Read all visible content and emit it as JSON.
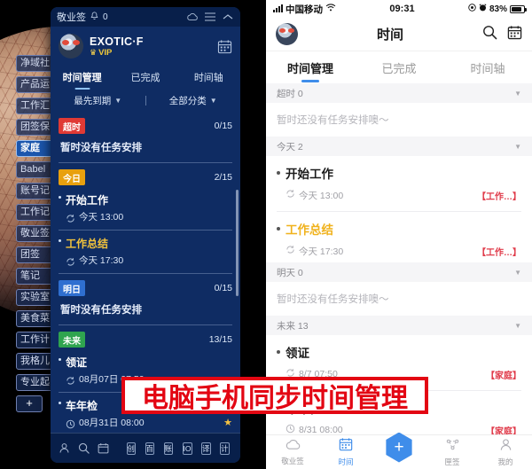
{
  "desktop": {
    "categories": [
      {
        "label": "净域社",
        "selected": false
      },
      {
        "label": "产品运",
        "selected": false
      },
      {
        "label": "工作汇",
        "selected": false
      },
      {
        "label": "团签保",
        "selected": false
      },
      {
        "label": "家庭",
        "selected": true
      },
      {
        "label": "Babel",
        "selected": false
      },
      {
        "label": "账号记",
        "selected": false
      },
      {
        "label": "工作记",
        "selected": false
      },
      {
        "label": "敬业签",
        "selected": false
      },
      {
        "label": "团签",
        "selected": false
      },
      {
        "label": "笔记",
        "selected": false
      },
      {
        "label": "实验室",
        "selected": false
      },
      {
        "label": "美食菜",
        "selected": false
      },
      {
        "label": "工作计",
        "selected": false
      },
      {
        "label": "我格儿",
        "selected": false
      },
      {
        "label": "专业起",
        "selected": false
      }
    ],
    "add_label": "+"
  },
  "window": {
    "titlebar": {
      "app_name": "敬业签",
      "bell_count": "0",
      "cloud_icon": "cloud-icon",
      "menu_icon": "hamburger-menu-icon",
      "minimize_icon": "chevron-up-icon"
    },
    "profile": {
      "username": "EXOTIC·F",
      "vip_label": "VIP",
      "crown": "♛",
      "calendar_icon": "calendar-icon"
    },
    "tabs": [
      {
        "label": "时间管理",
        "active": true
      },
      {
        "label": "已完成",
        "active": false
      },
      {
        "label": "时间轴",
        "active": false
      }
    ],
    "filters": {
      "sort_label": "最先到期",
      "category_label": "全部分类"
    },
    "groups": [
      {
        "badge": "超时",
        "badge_color": "#e03a35",
        "count": "0/15",
        "empty_text": "暂时没有任务安排",
        "tasks": []
      },
      {
        "badge": "今日",
        "badge_color": "#e8a00e",
        "count": "2/15",
        "empty_text": "",
        "tasks": [
          {
            "title": "开始工作",
            "time": "今天 13:00",
            "warn": false,
            "starred": false,
            "icon": "repeat-icon"
          },
          {
            "title": "工作总结",
            "time": "今天 17:30",
            "warn": true,
            "starred": false,
            "icon": "repeat-icon"
          }
        ]
      },
      {
        "badge": "明日",
        "badge_color": "#2f6fd0",
        "count": "0/15",
        "empty_text": "暂时没有任务安排",
        "tasks": []
      },
      {
        "badge": "未来",
        "badge_color": "#2fa44f",
        "count": "13/15",
        "empty_text": "",
        "tasks": [
          {
            "title": "领证",
            "time": "08月07日 07:50",
            "warn": false,
            "starred": false,
            "icon": "repeat-icon"
          },
          {
            "title": "车年检",
            "time": "08月31日 08:00",
            "warn": false,
            "starred": true,
            "icon": "clock-icon"
          }
        ]
      }
    ],
    "toolbar": {
      "user_icon": "user-icon",
      "search_icon": "search-icon",
      "calendar_icon": "calendar-icon",
      "quick_buttons": [
        "创",
        "百",
        "账",
        "IO",
        "译",
        "计"
      ],
      "more_icon": "vertical-dots-icon"
    }
  },
  "phone": {
    "statusbar": {
      "carrier": "中国移动",
      "signal_icon": "signal-bars-icon",
      "wifi_icon": "wifi-icon",
      "time": "09:31",
      "location_icon": "location-icon",
      "alarm_icon": "alarm-icon",
      "battery_percent": "83%",
      "battery_icon": "battery-icon"
    },
    "header": {
      "title": "时间",
      "avatar": "user-avatar",
      "search_icon": "search-icon",
      "calendar_icon": "calendar-icon"
    },
    "tabs": [
      {
        "label": "时间管理",
        "active": true
      },
      {
        "label": "已完成",
        "active": false
      },
      {
        "label": "时间轴",
        "active": false
      }
    ],
    "sections": [
      {
        "title": "超时 0",
        "empty_text": "暂时还没有任务安排噢～",
        "tasks": []
      },
      {
        "title": "今天 2",
        "empty_text": "",
        "tasks": [
          {
            "title": "开始工作",
            "time": "今天 13:00",
            "tag": "【工作…】",
            "warn": false,
            "icon": "repeat-icon"
          },
          {
            "title": "工作总结",
            "time": "今天 17:30",
            "tag": "【工作…】",
            "warn": true,
            "icon": "repeat-icon"
          }
        ]
      },
      {
        "title": "明天 0",
        "empty_text": "暂时还没有任务安排噢～",
        "tasks": []
      },
      {
        "title": "未来 13",
        "empty_text": "",
        "tasks": [
          {
            "title": "领证",
            "time": "8/7 07:50",
            "tag": "【家庭】",
            "warn": false,
            "icon": "repeat-icon"
          },
          {
            "title": "车年检",
            "time": "8/31 08:00",
            "tag": "【家庭】",
            "warn": false,
            "icon": "clock-icon"
          }
        ]
      }
    ],
    "tabbar": [
      {
        "label": "敬业签",
        "icon": "cloud-icon",
        "active": false
      },
      {
        "label": "时间",
        "icon": "calendar-icon",
        "active": true
      },
      {
        "label": "",
        "icon": "plus-icon",
        "active": false
      },
      {
        "label": "匣签",
        "icon": "nodes-icon",
        "active": false
      },
      {
        "label": "我的",
        "icon": "person-icon",
        "active": false
      }
    ],
    "add_label": "+"
  },
  "overlay": {
    "text": "电脑手机同步时间管理",
    "border_color": "#e30613",
    "text_color": "#e30613"
  }
}
